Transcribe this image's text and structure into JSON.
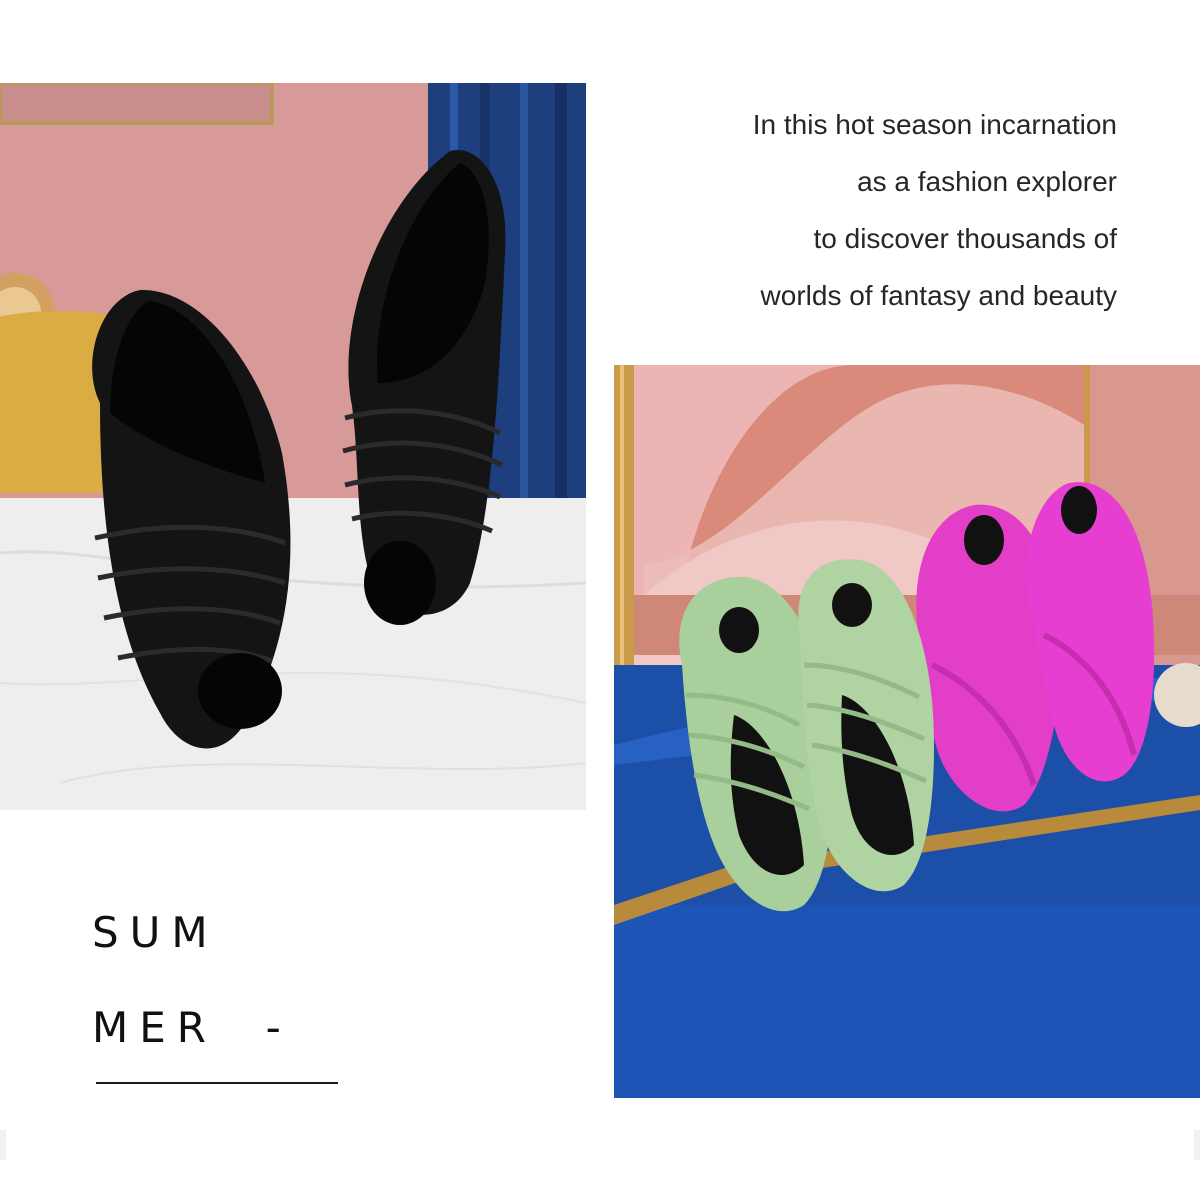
{
  "tagline": {
    "lines": [
      "In this hot season incarnation",
      "as a fashion explorer",
      "to discover thousands of",
      "worlds of fantasy and beauty"
    ]
  },
  "heading": {
    "line1": "SUM",
    "line2": "MER  -"
  },
  "colors": {
    "slide_black": "#141414",
    "slide_green": "#a9cf9c",
    "slide_pink": "#e33ec8",
    "floor_blue": "#1b4fa8",
    "wall_pink": "#d79a99"
  }
}
